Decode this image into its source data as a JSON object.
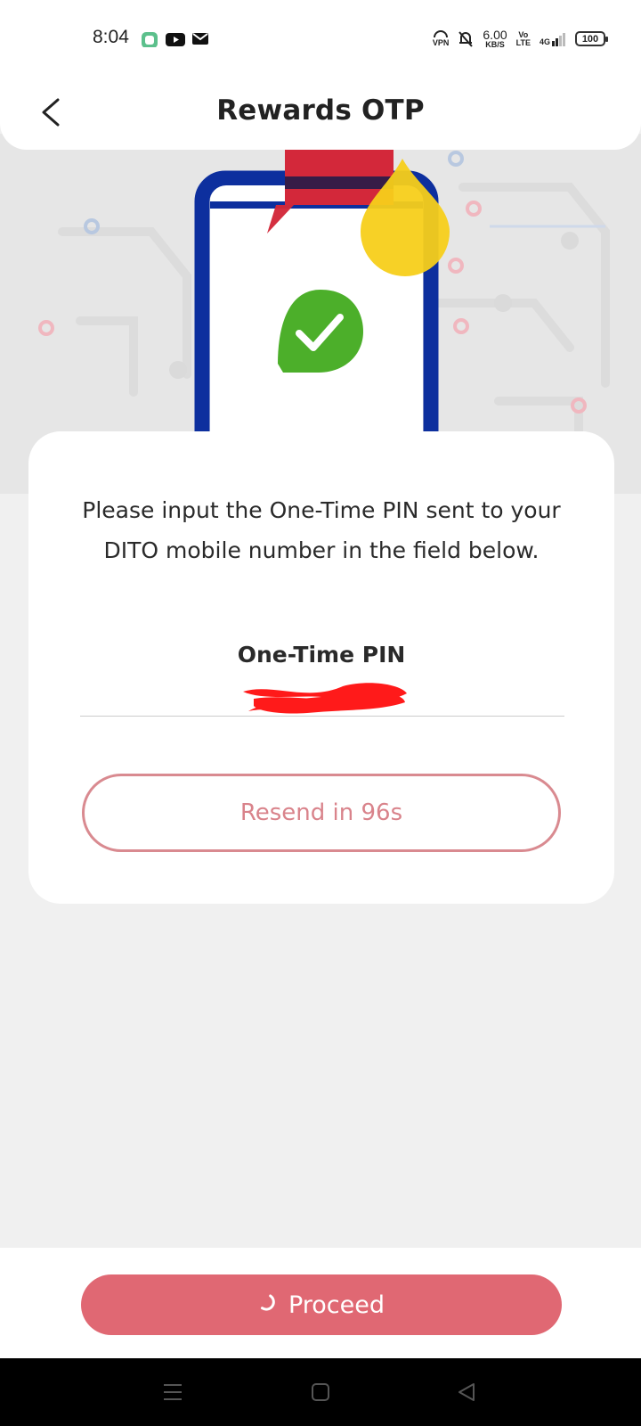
{
  "status_bar": {
    "time": "8:04",
    "vpn": "VPN",
    "speed_value": "6.00",
    "speed_unit": "KB/S",
    "volte_top": "Vo",
    "volte_bottom": "LTE",
    "network": "4G",
    "battery": "100"
  },
  "header": {
    "title": "Rewards OTP"
  },
  "card": {
    "instructions": "Please input the One-Time PIN sent to your DITO mobile number in the field below.",
    "pin_label": "One-Time PIN",
    "pin_value": "",
    "resend_label": "Resend in 96s"
  },
  "footer": {
    "proceed_label": "Proceed"
  },
  "colors": {
    "accent": "#e06873",
    "accent_outline": "#d98a90",
    "check_green": "#4caf2a",
    "phone_blue": "#0d2f9e",
    "brand_red": "#d3283a",
    "brand_yellow": "#f7cf1a"
  },
  "icons": {
    "back": "chevron-left-icon",
    "spinner": "loading-spinner-icon",
    "check": "check-icon"
  }
}
